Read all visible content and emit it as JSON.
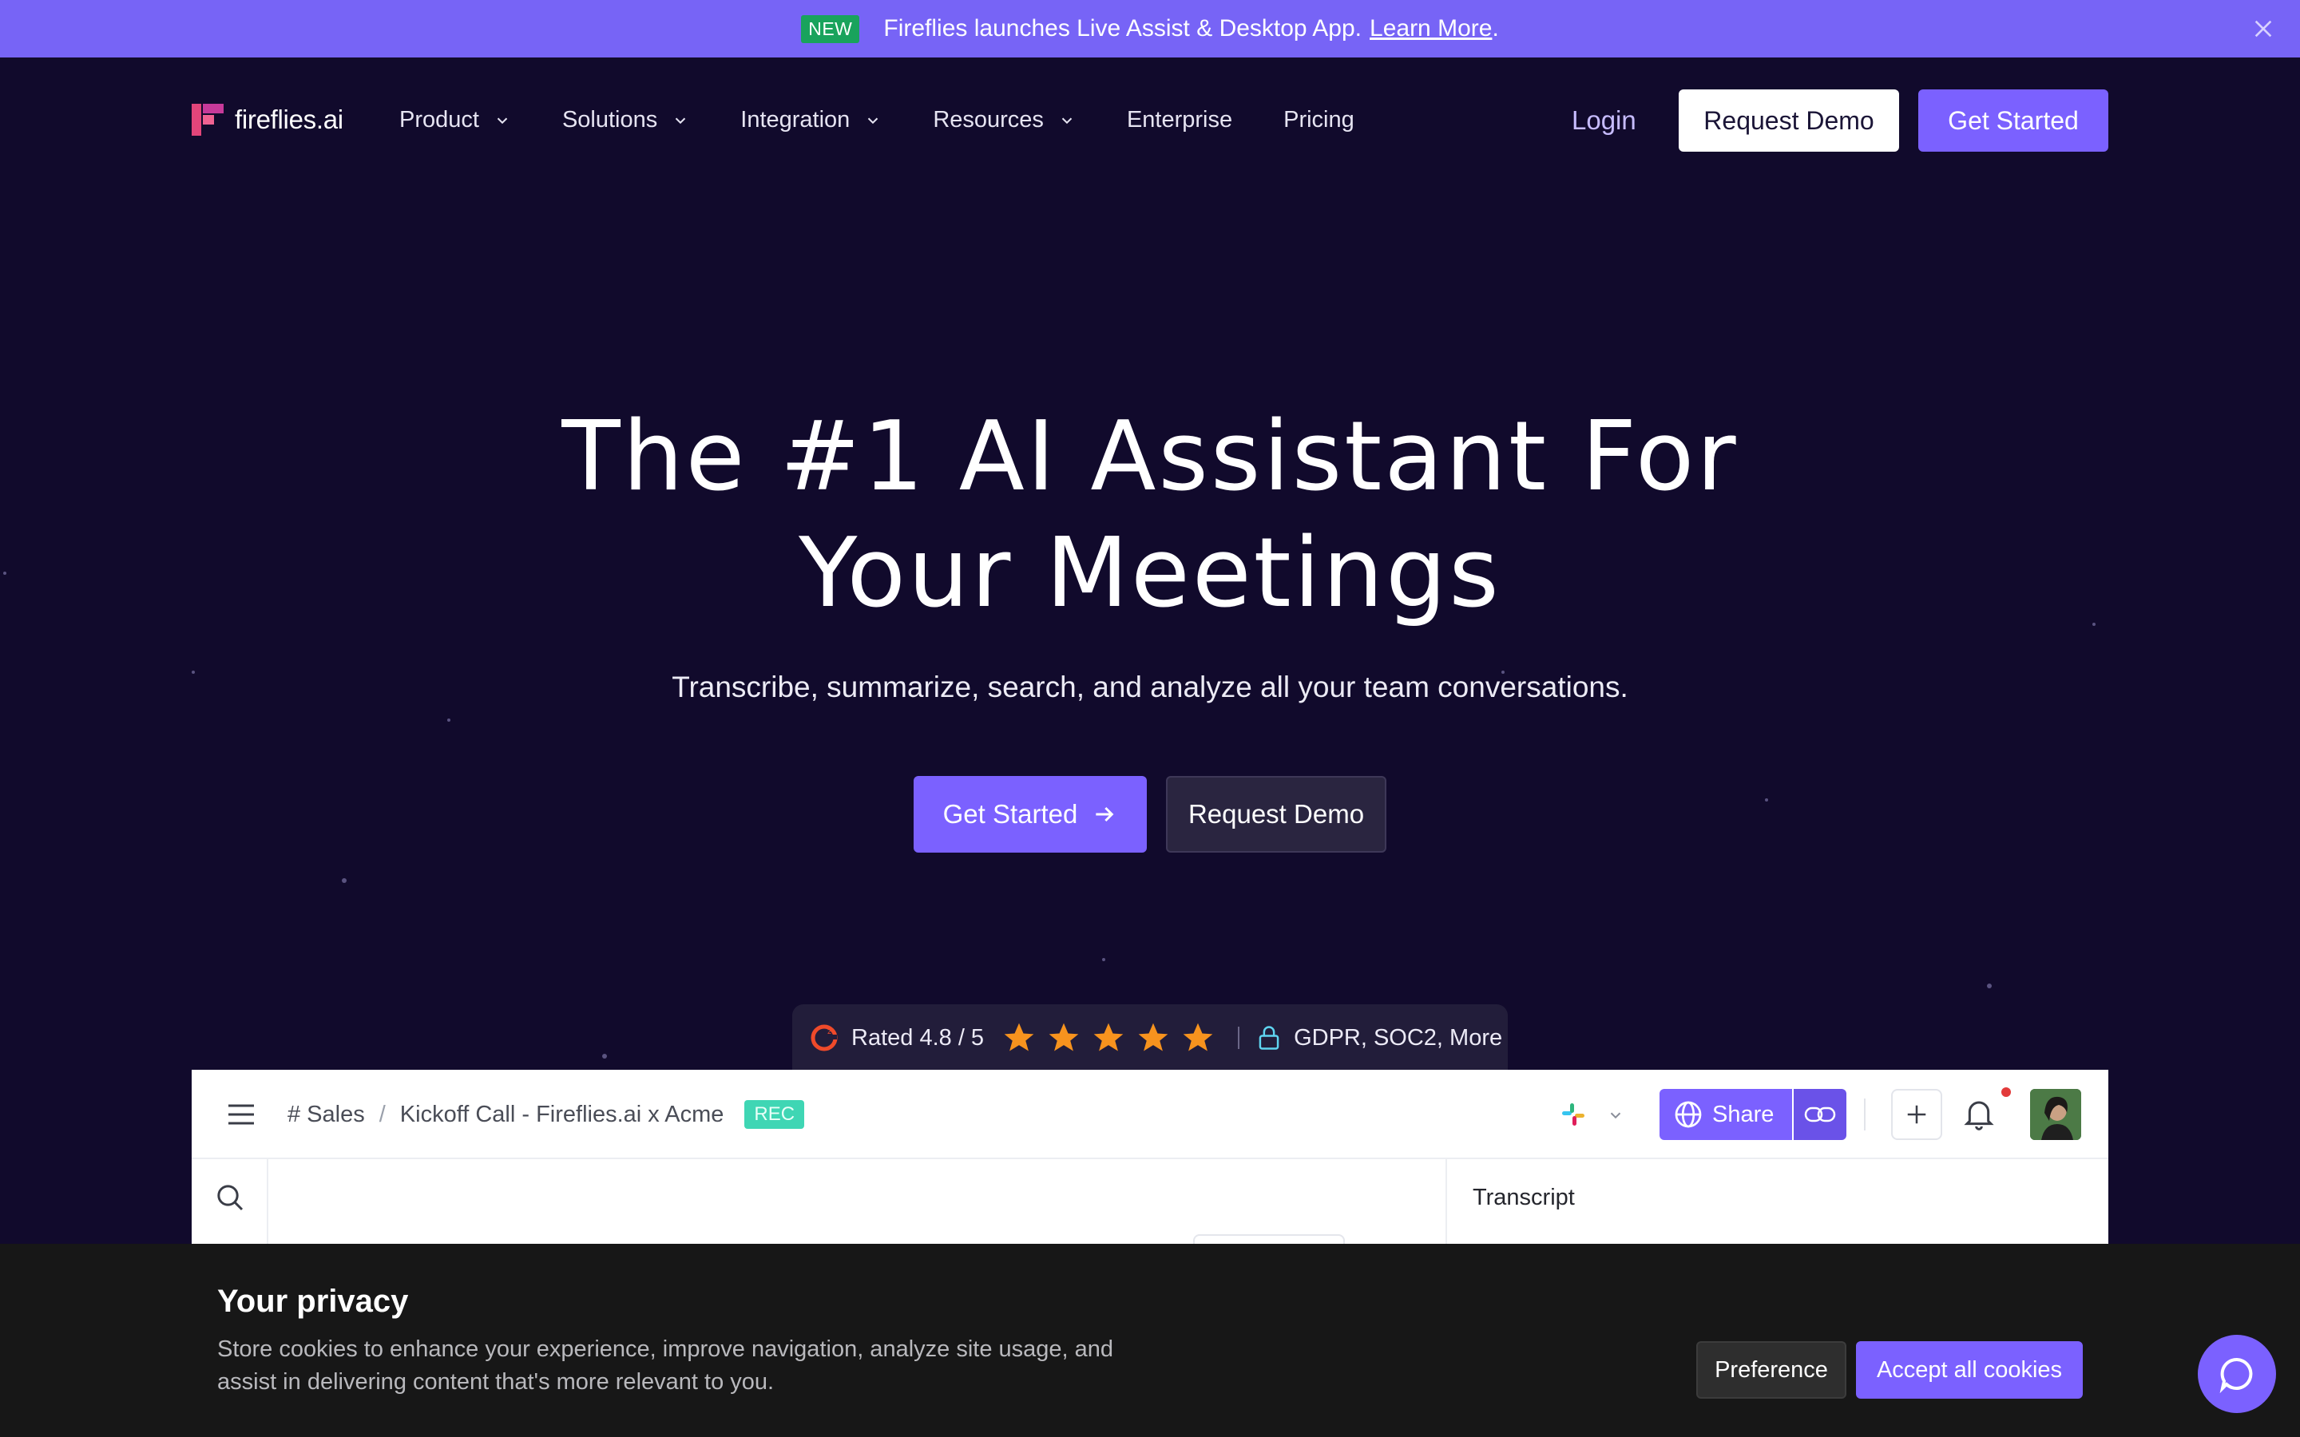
{
  "announcement": {
    "badge": "NEW",
    "text": "Fireflies launches Live Assist & Desktop App.",
    "link": "Learn More",
    "suffix": ".",
    "background": "#7764f6"
  },
  "nav": {
    "logo_text": "fireflies.ai",
    "menu": [
      {
        "label": "Product",
        "has_dropdown": true
      },
      {
        "label": "Solutions",
        "has_dropdown": true
      },
      {
        "label": "Integration",
        "has_dropdown": true
      },
      {
        "label": "Resources",
        "has_dropdown": true
      },
      {
        "label": "Enterprise",
        "has_dropdown": false
      },
      {
        "label": "Pricing",
        "has_dropdown": false
      }
    ],
    "login": "Login",
    "request_demo": "Request Demo",
    "get_started": "Get Started"
  },
  "hero": {
    "title_line1": "The #1 AI Assistant For",
    "title_line2": "Your Meetings",
    "subtitle": "Transcribe, summarize, search, and analyze all your team conversations.",
    "cta_primary": "Get Started",
    "cta_secondary": "Request Demo"
  },
  "rating": {
    "text": "Rated 4.8 / 5",
    "stars": 5,
    "compliance": "GDPR, SOC2, More"
  },
  "app_preview": {
    "channel": "# Sales",
    "separator": "/",
    "meeting_title": "Kickoff Call - Fireflies.ai x Acme",
    "rec_badge": "REC",
    "share": "Share",
    "panel_title": "Transcript"
  },
  "cookie": {
    "title": "Your privacy",
    "text": "Store cookies to enhance your experience, improve navigation, analyze site usage, and assist in delivering content that's more relevant to you.",
    "preference": "Preference",
    "accept": "Accept all cookies"
  },
  "colors": {
    "page_bg": "#110a2c",
    "accent": "#7b61ff",
    "star": "#f7931e",
    "rec": "#3fd6b4"
  }
}
